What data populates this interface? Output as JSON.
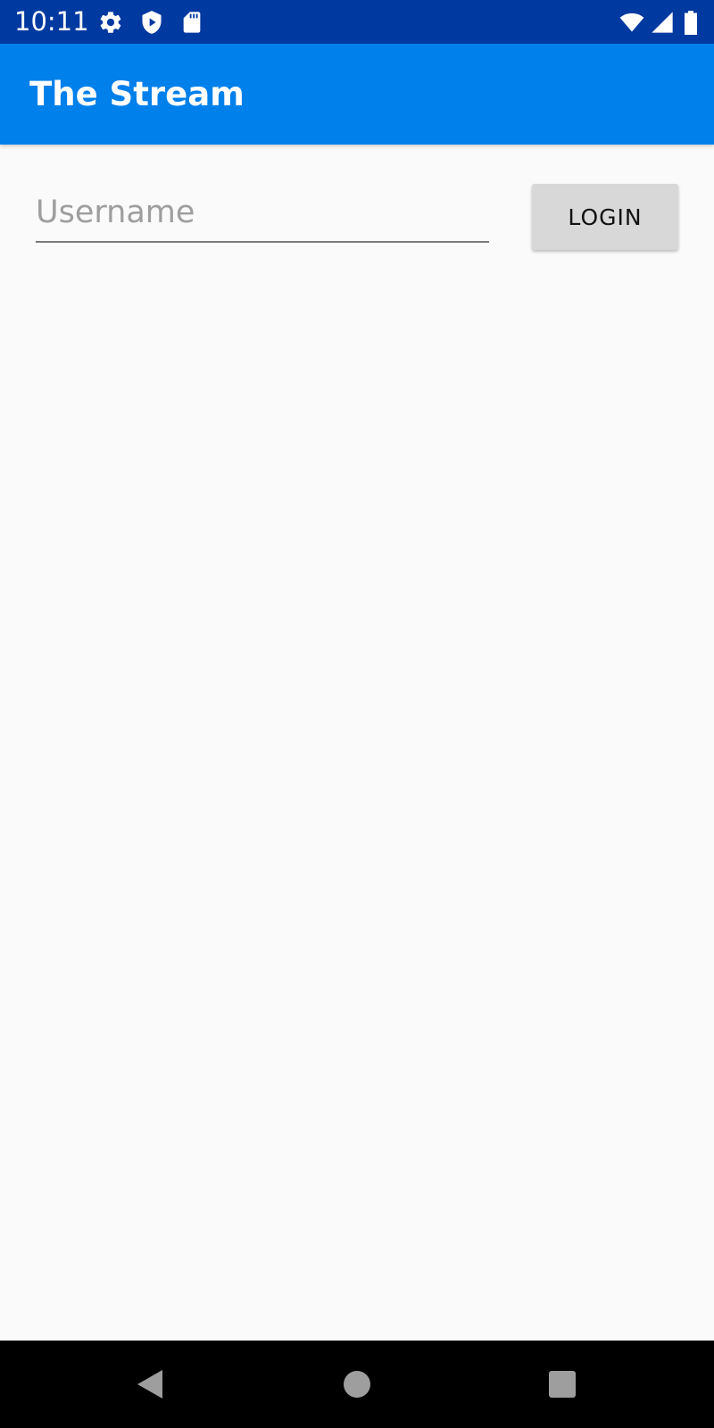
{
  "status_bar": {
    "time": "10:11",
    "icons": [
      "gear-icon",
      "shield-play-icon",
      "sd-card-icon",
      "wifi-icon",
      "signal-icon",
      "battery-icon"
    ]
  },
  "app_bar": {
    "title": "The Stream"
  },
  "login_form": {
    "username_placeholder": "Username",
    "username_value": "",
    "login_label": "LOGIN"
  },
  "nav_bar": {
    "buttons": [
      "back-icon",
      "home-icon",
      "recents-icon"
    ]
  },
  "colors": {
    "status_bar": "#0039a0",
    "app_bar": "#0080ea",
    "background": "#fafafa",
    "button": "#d8d8d8"
  }
}
